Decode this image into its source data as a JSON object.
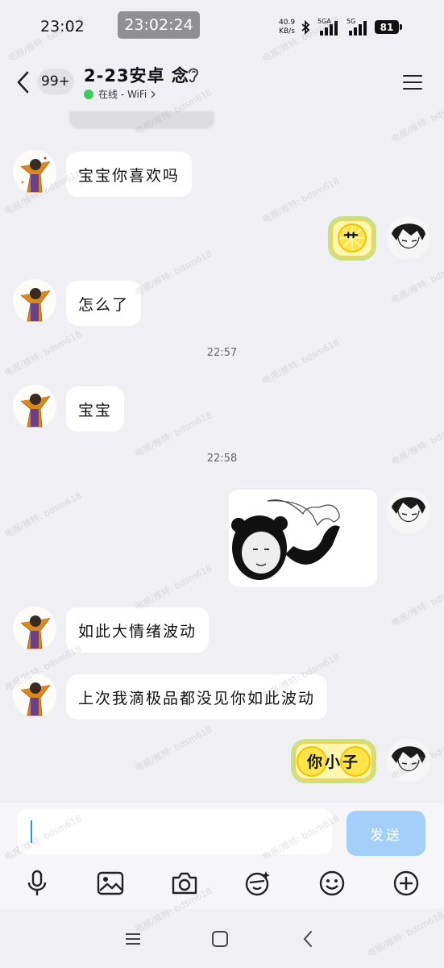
{
  "status_bar": {
    "clock": "23:02",
    "recording_time": "23:02:24",
    "net_speed_value": "40.9",
    "net_speed_unit": "KB/s",
    "sim1_label": "5GA",
    "sim2_label": "5G",
    "battery": "81"
  },
  "header": {
    "unread_count": "99+",
    "title": "2-23安卓 念",
    "online_status": "在线 - WiFi"
  },
  "messages": [
    {
      "sender": "her",
      "type": "text",
      "text": "宝宝你喜欢吗"
    },
    {
      "sender": "me",
      "type": "text",
      "text": "艹"
    },
    {
      "sender": "her",
      "type": "text",
      "text": "怎么了"
    },
    {
      "type": "time",
      "text": "22:57"
    },
    {
      "sender": "her",
      "type": "text",
      "text": "宝宝"
    },
    {
      "type": "time",
      "text": "22:58"
    },
    {
      "sender": "me",
      "type": "sticker",
      "icon": "panda-meme-sticker"
    },
    {
      "sender": "her",
      "type": "text",
      "text": "如此大情绪波动"
    },
    {
      "sender": "her",
      "type": "text",
      "text": "上次我滴极品都没见你如此波动"
    },
    {
      "sender": "me",
      "type": "text",
      "text": "你小子"
    }
  ],
  "input": {
    "value": "",
    "send_label": "发送"
  },
  "toolbar_icons": [
    "microphone-icon",
    "image-icon",
    "camera-icon",
    "red-packet-icon",
    "emoji-icon",
    "plus-icon"
  ],
  "watermark": "电报/推特: bdsm618",
  "colors": {
    "send_button": "#a3cff8",
    "online_dot": "#3ccb5a",
    "my_bubble_fill": "#fff7b0",
    "my_bubble_border": "#c8e08a"
  }
}
